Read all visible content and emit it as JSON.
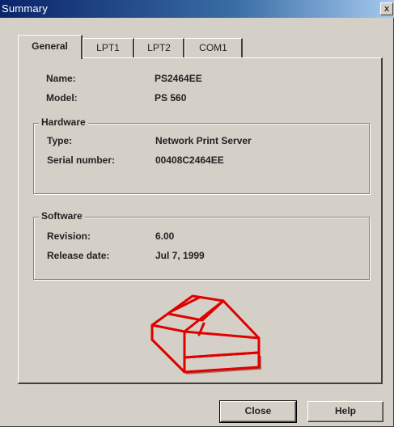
{
  "window": {
    "title": "Summary",
    "close_glyph": "x"
  },
  "tabs": [
    {
      "label": "General",
      "active": true
    },
    {
      "label": "LPT1",
      "active": false
    },
    {
      "label": "LPT2",
      "active": false
    },
    {
      "label": "COM1",
      "active": false
    }
  ],
  "general": {
    "name_label": "Name:",
    "name_value": "PS2464EE",
    "model_label": "Model:",
    "model_value": "PS 560"
  },
  "hardware": {
    "title": "Hardware",
    "type_label": "Type:",
    "type_value": "Network Print Server",
    "serial_label": "Serial number:",
    "serial_value": "00408C2464EE"
  },
  "software": {
    "title": "Software",
    "revision_label": "Revision:",
    "revision_value": "6.00",
    "release_label": "Release date:",
    "release_value": "Jul  7, 1999"
  },
  "buttons": {
    "close": "Close",
    "help": "Help"
  },
  "icons": {
    "device": "print-server-device-icon",
    "device_color": "#e00000"
  }
}
